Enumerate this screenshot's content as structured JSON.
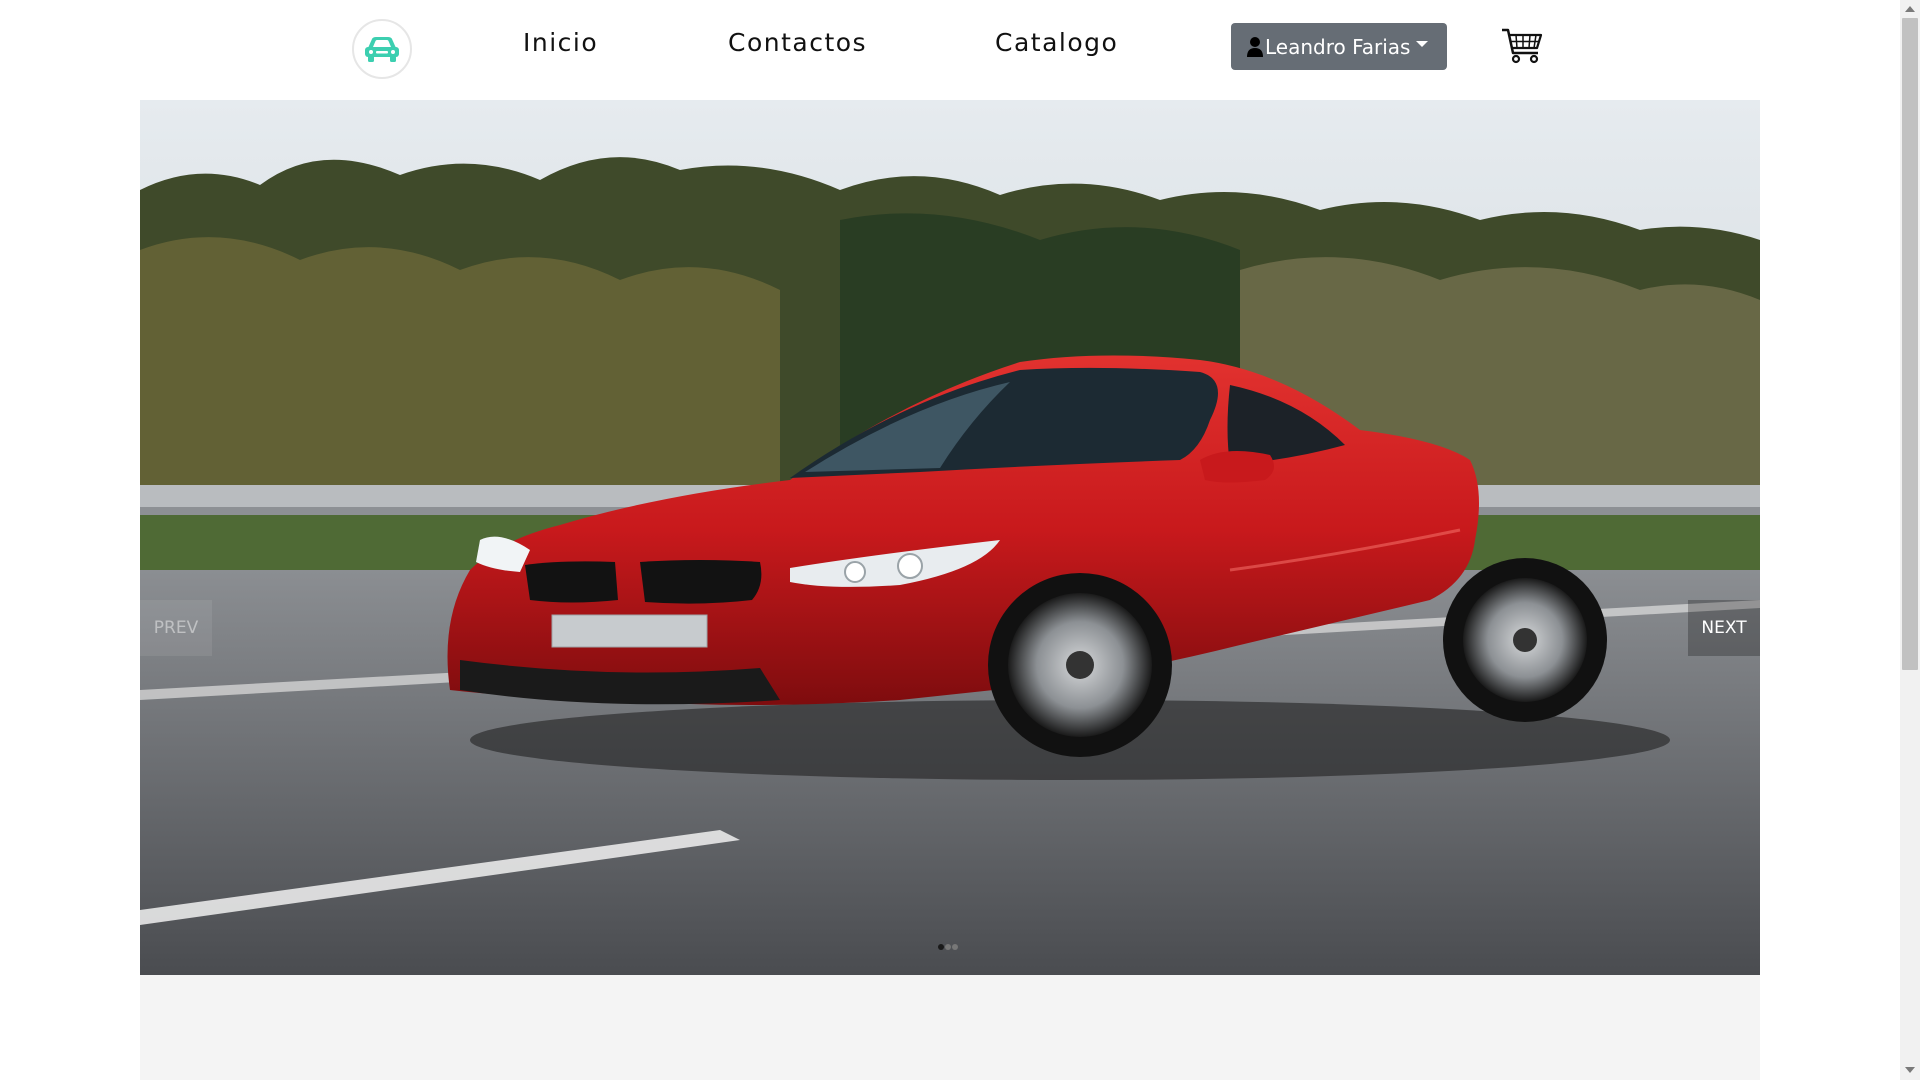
{
  "nav": {
    "links": [
      {
        "label": "Inicio"
      },
      {
        "label": "Contactos"
      },
      {
        "label": "Catalogo"
      }
    ],
    "user": {
      "name": "Leandro Farias",
      "icon": "user-icon"
    },
    "cart_icon": "cart-icon",
    "logo_icon": "car-icon",
    "logo_color": "#3ccfb0"
  },
  "carousel": {
    "prev_label": "PREV",
    "next_label": "NEXT",
    "slide_count": 3,
    "active_slide": 1,
    "slide_image": "red-coupe-on-highway"
  },
  "colors": {
    "user_button_bg": "#666d75",
    "car_body": "#c8191c"
  }
}
